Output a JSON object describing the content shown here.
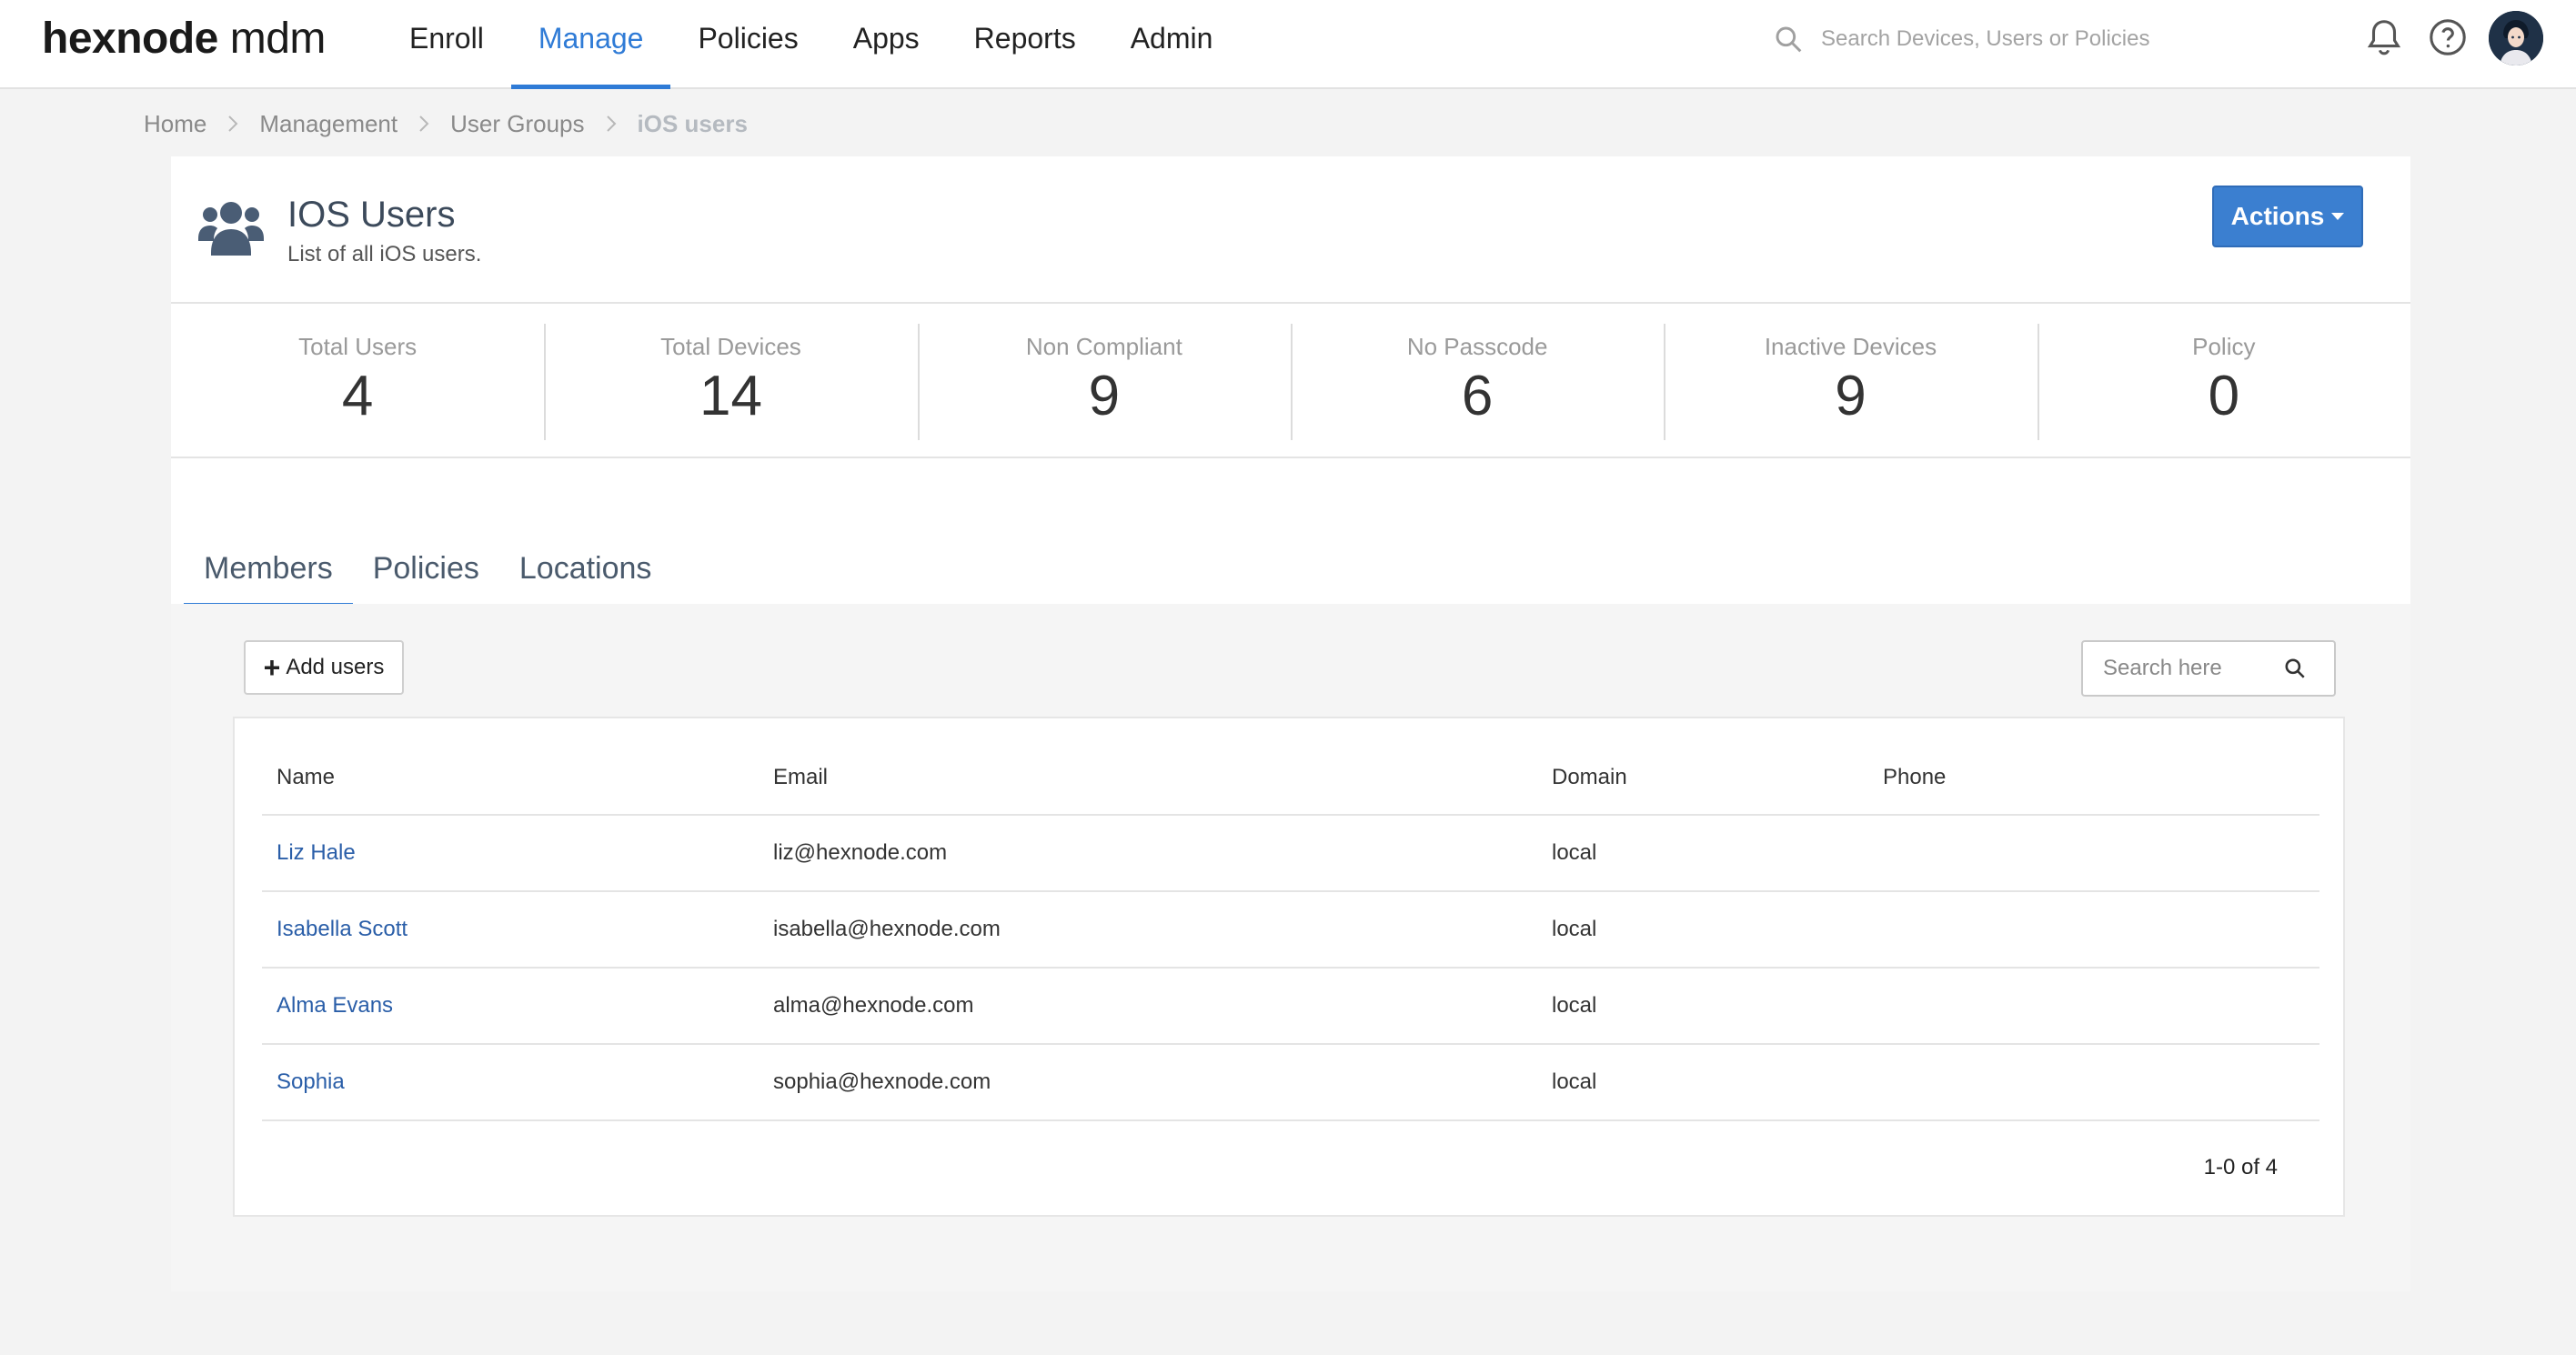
{
  "brand": {
    "name": "hexnode",
    "suffix": "mdm"
  },
  "nav": {
    "items": [
      {
        "label": "Enroll",
        "active": false
      },
      {
        "label": "Manage",
        "active": true
      },
      {
        "label": "Policies",
        "active": false
      },
      {
        "label": "Apps",
        "active": false
      },
      {
        "label": "Reports",
        "active": false
      },
      {
        "label": "Admin",
        "active": false
      }
    ],
    "search_placeholder": "Search Devices, Users or Policies",
    "icons": [
      "search-icon",
      "bell-icon",
      "help-icon",
      "avatar"
    ]
  },
  "breadcrumb": [
    "Home",
    "Management",
    "User Groups",
    "iOS users"
  ],
  "header": {
    "title": "IOS Users",
    "subtitle": "List of all iOS users.",
    "actions_label": "Actions"
  },
  "stats": [
    {
      "label": "Total Users",
      "value": "4"
    },
    {
      "label": "Total Devices",
      "value": "14"
    },
    {
      "label": "Non Compliant",
      "value": "9"
    },
    {
      "label": "No Passcode",
      "value": "6"
    },
    {
      "label": "Inactive Devices",
      "value": "9"
    },
    {
      "label": "Policy",
      "value": "0"
    }
  ],
  "tabs": [
    {
      "label": "Members",
      "active": true
    },
    {
      "label": "Policies",
      "active": false
    },
    {
      "label": "Locations",
      "active": false
    }
  ],
  "members": {
    "add_users_label": "Add users",
    "search_placeholder": "Search here",
    "columns": [
      "Name",
      "Email",
      "Domain",
      "Phone"
    ],
    "rows": [
      {
        "name": "Liz Hale",
        "email": "liz@hexnode.com",
        "domain": "local",
        "phone": ""
      },
      {
        "name": "Isabella Scott",
        "email": "isabella@hexnode.com",
        "domain": "local",
        "phone": ""
      },
      {
        "name": "Alma Evans",
        "email": "alma@hexnode.com",
        "domain": "local",
        "phone": ""
      },
      {
        "name": "Sophia",
        "email": "sophia@hexnode.com",
        "domain": "local",
        "phone": ""
      }
    ],
    "pagination": "1-0 of 4"
  },
  "colors": {
    "accent": "#2f7bd6",
    "button_primary": "#3b7fd0",
    "link": "#2a5ea8",
    "page_bg": "#f3f3f3"
  }
}
